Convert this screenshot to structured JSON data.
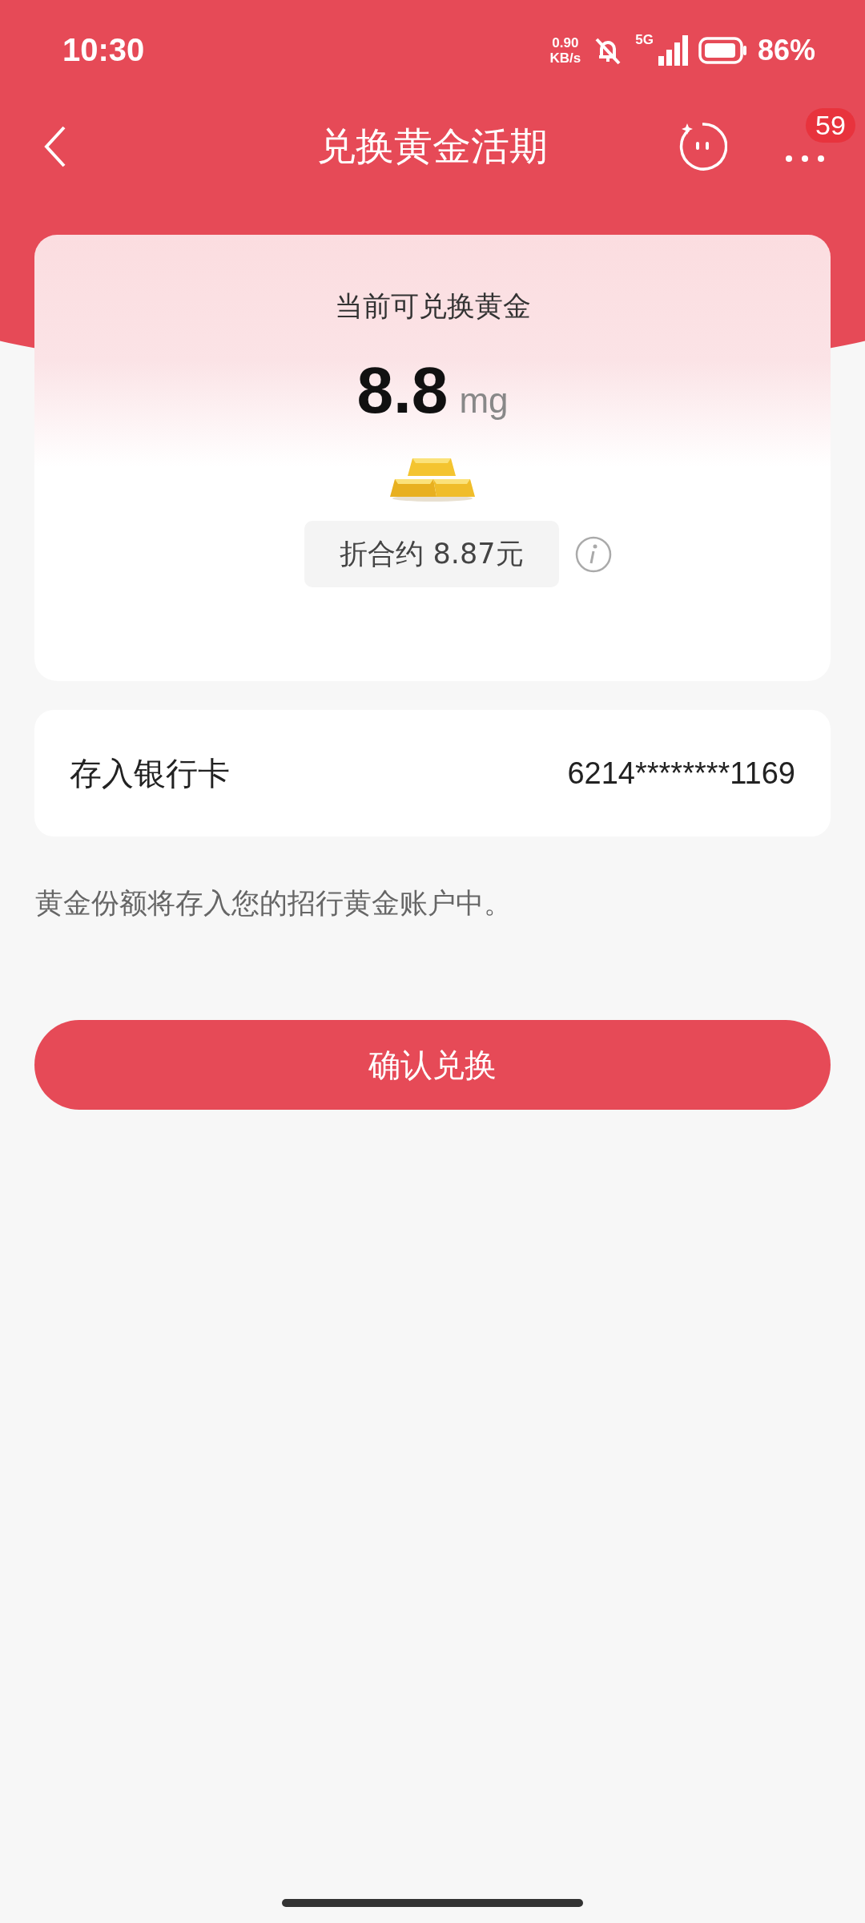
{
  "status_bar": {
    "time": "10:30",
    "net_speed": "0.90",
    "net_unit": "KB/s",
    "network": "5G",
    "battery": "86%"
  },
  "nav": {
    "title": "兑换黄金活期",
    "badge": "59"
  },
  "card": {
    "title": "当前可兑换黄金",
    "amount": "8.8",
    "unit": "mg",
    "equivalent": "折合约 8.87元"
  },
  "bank_row": {
    "label": "存入银行卡",
    "value": "6214********1169"
  },
  "note": "黄金份额将存入您的招行黄金账户中。",
  "confirm_button": "确认兑换"
}
